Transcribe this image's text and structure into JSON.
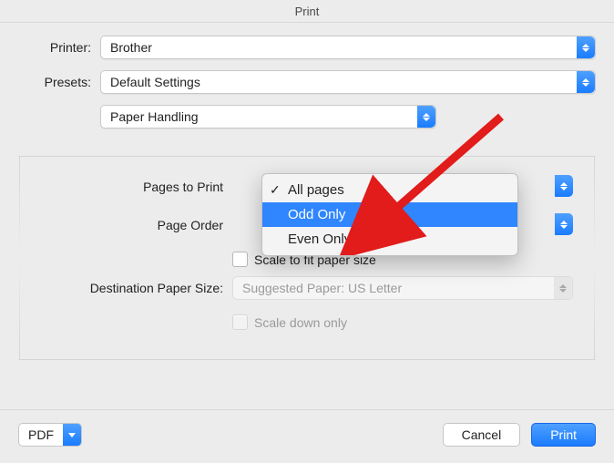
{
  "window": {
    "title": "Print"
  },
  "labels": {
    "printer": "Printer:",
    "presets": "Presets:",
    "pages_to_print": "Pages to Print",
    "page_order": "Page Order",
    "dest_paper_size": "Destination Paper Size:"
  },
  "fields": {
    "printer": "Brother",
    "presets": "Default Settings",
    "section": "Paper Handling",
    "dest_paper_size": "Suggested Paper: US Letter"
  },
  "checkboxes": {
    "scale_to_fit": "Scale to fit paper size",
    "scale_down_only": "Scale down only"
  },
  "dropdown": {
    "options": [
      "All pages",
      "Odd Only",
      "Even Only"
    ],
    "selected_index": 0,
    "highlighted_index": 1
  },
  "footer": {
    "pdf": "PDF",
    "cancel": "Cancel",
    "print": "Print"
  }
}
